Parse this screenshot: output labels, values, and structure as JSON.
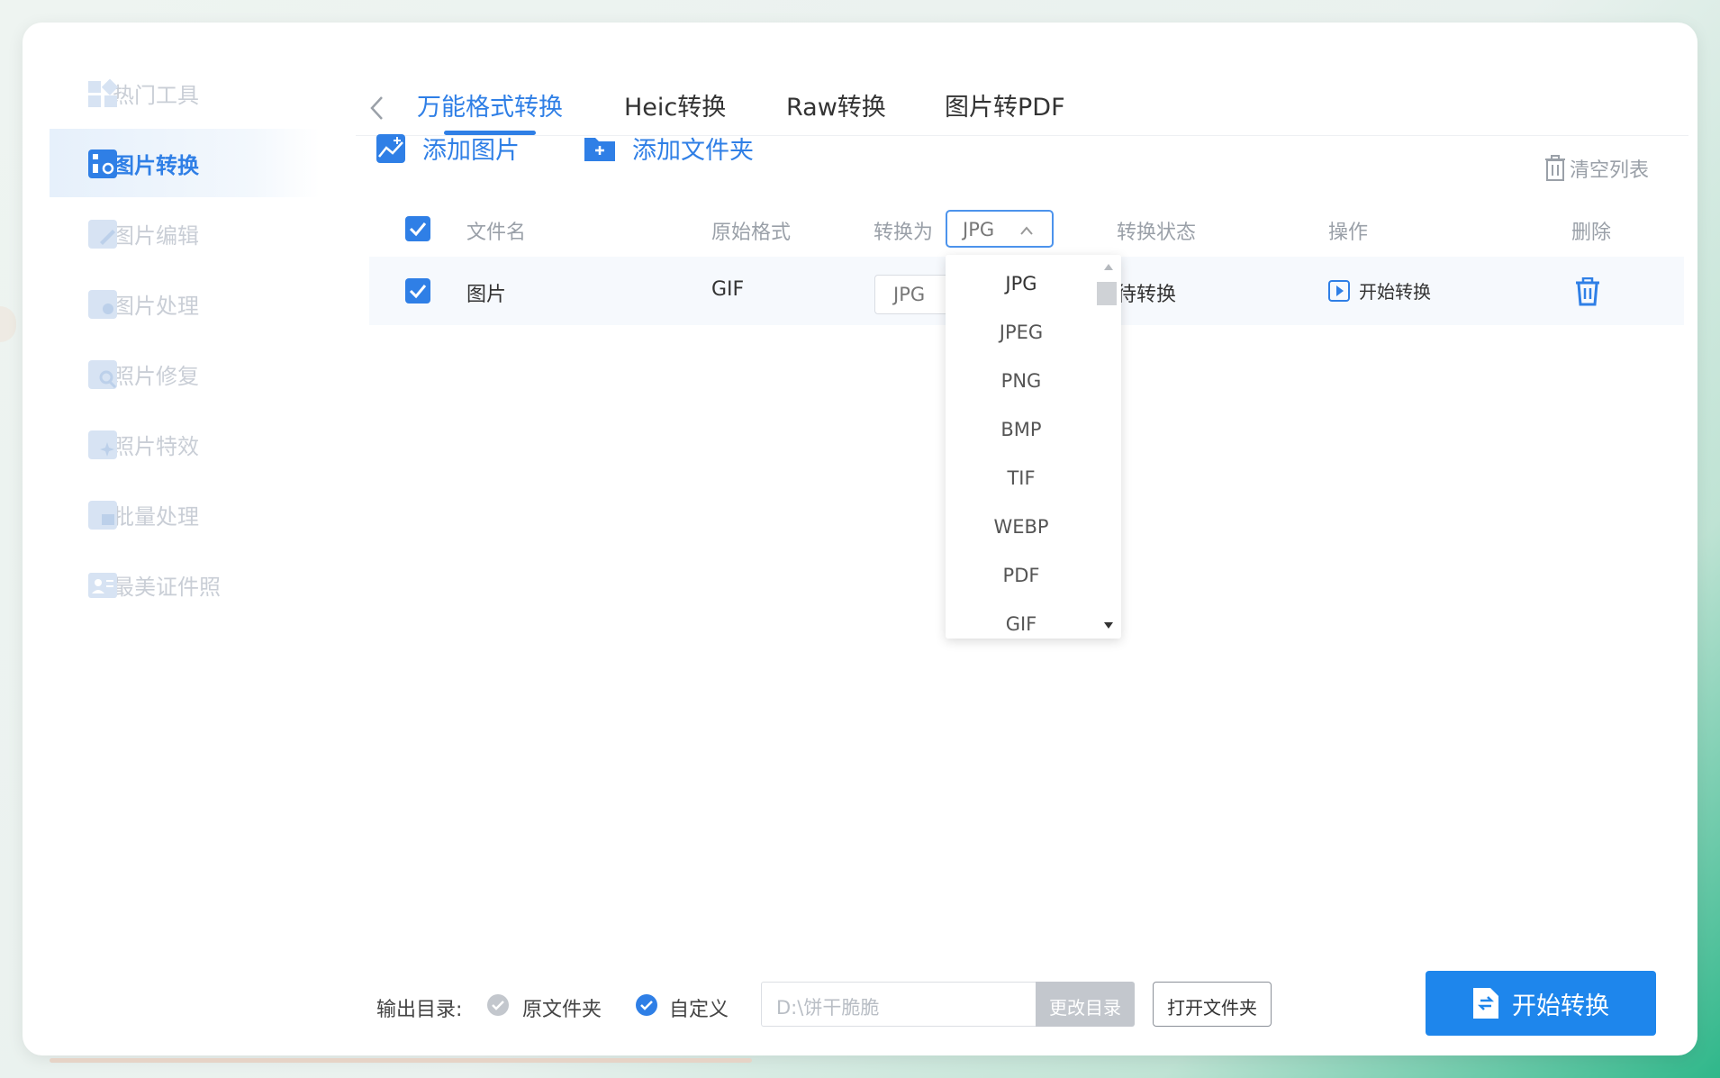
{
  "colors": {
    "accent": "#2f7fe6",
    "muted": "#c9ced6",
    "button": "#1e86ec"
  },
  "sidebar": {
    "items": [
      {
        "label": "热门工具",
        "icon": "hot-tools-icon",
        "active": false
      },
      {
        "label": "图片转换",
        "icon": "image-convert-icon",
        "active": true
      },
      {
        "label": "图片编辑",
        "icon": "image-edit-icon",
        "active": false
      },
      {
        "label": "图片处理",
        "icon": "image-process-icon",
        "active": false
      },
      {
        "label": "照片修复",
        "icon": "photo-repair-icon",
        "active": false
      },
      {
        "label": "照片特效",
        "icon": "photo-effects-icon",
        "active": false
      },
      {
        "label": "批量处理",
        "icon": "batch-process-icon",
        "active": false
      },
      {
        "label": "最美证件照",
        "icon": "id-photo-icon",
        "active": false
      }
    ]
  },
  "tabs": [
    {
      "label": "万能格式转换",
      "active": true
    },
    {
      "label": "Heic转换",
      "active": false
    },
    {
      "label": "Raw转换",
      "active": false
    },
    {
      "label": "图片转PDF",
      "active": false
    }
  ],
  "toolbar": {
    "add_image": "添加图片",
    "add_folder": "添加文件夹",
    "clear_list": "清空列表"
  },
  "table": {
    "headers": {
      "filename": "文件名",
      "original_format": "原始格式",
      "convert_to": "转换为",
      "status": "转换状态",
      "action": "操作",
      "delete": "删除"
    },
    "header_select_value": "JPG",
    "rows": [
      {
        "filename": "图片",
        "original_format": "GIF",
        "target_format": "JPG",
        "status": "待转换",
        "action": "开始转换",
        "checked": true
      }
    ]
  },
  "dropdown": {
    "options": [
      "JPG",
      "JPEG",
      "PNG",
      "BMP",
      "TIF",
      "WEBP",
      "PDF",
      "GIF"
    ],
    "selected": "JPG"
  },
  "footer": {
    "output_label": "输出目录:",
    "option_original": "原文件夹",
    "option_custom": "自定义",
    "path_placeholder": "D:\\饼干脆脆",
    "change_dir": "更改目录",
    "open_folder": "打开文件夹",
    "start": "开始转换"
  }
}
